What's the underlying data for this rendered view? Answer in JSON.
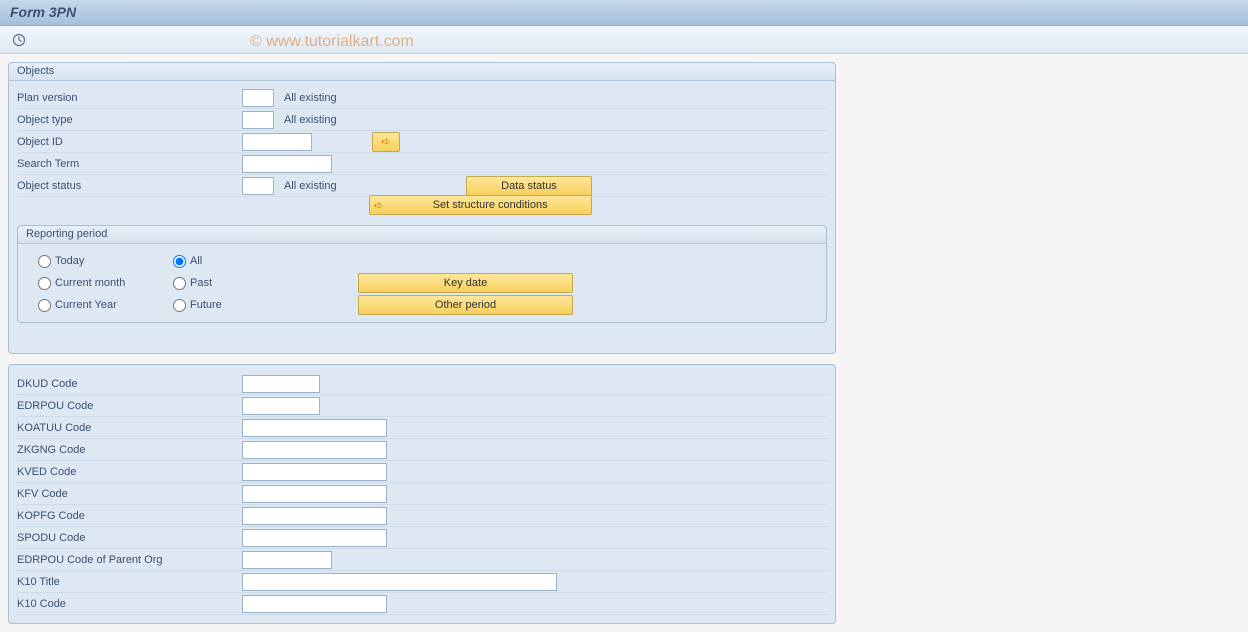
{
  "title": "Form 3PN",
  "watermark": "© www.tutorialkart.com",
  "objects": {
    "header": "Objects",
    "plan_version": {
      "label": "Plan version",
      "after": "All existing"
    },
    "object_type": {
      "label": "Object type",
      "after": "All existing"
    },
    "object_id": {
      "label": "Object ID"
    },
    "search_term": {
      "label": "Search Term"
    },
    "object_status": {
      "label": "Object status",
      "after": "All existing"
    },
    "data_status_btn": "Data status",
    "struct_btn": "Set structure conditions"
  },
  "reporting": {
    "header": "Reporting period",
    "today": "Today",
    "all": "All",
    "current_month": "Current month",
    "past": "Past",
    "current_year": "Current Year",
    "future": "Future",
    "key_date_btn": "Key date",
    "other_period_btn": "Other period",
    "selected": "all"
  },
  "codes": {
    "dkud": "DKUD Code",
    "edrpou": "EDRPOU Code",
    "koatuu": "KOATUU Code",
    "zkgng": "ZKGNG Code",
    "kved": "KVED Code",
    "kfv": "KFV Code",
    "kopfg": "KOPFG Code",
    "spodu": "SPODU Code",
    "edrpou_parent": "EDRPOU Code of Parent Org",
    "k10_title": "K10 Title",
    "k10_code": "K10 Code"
  }
}
